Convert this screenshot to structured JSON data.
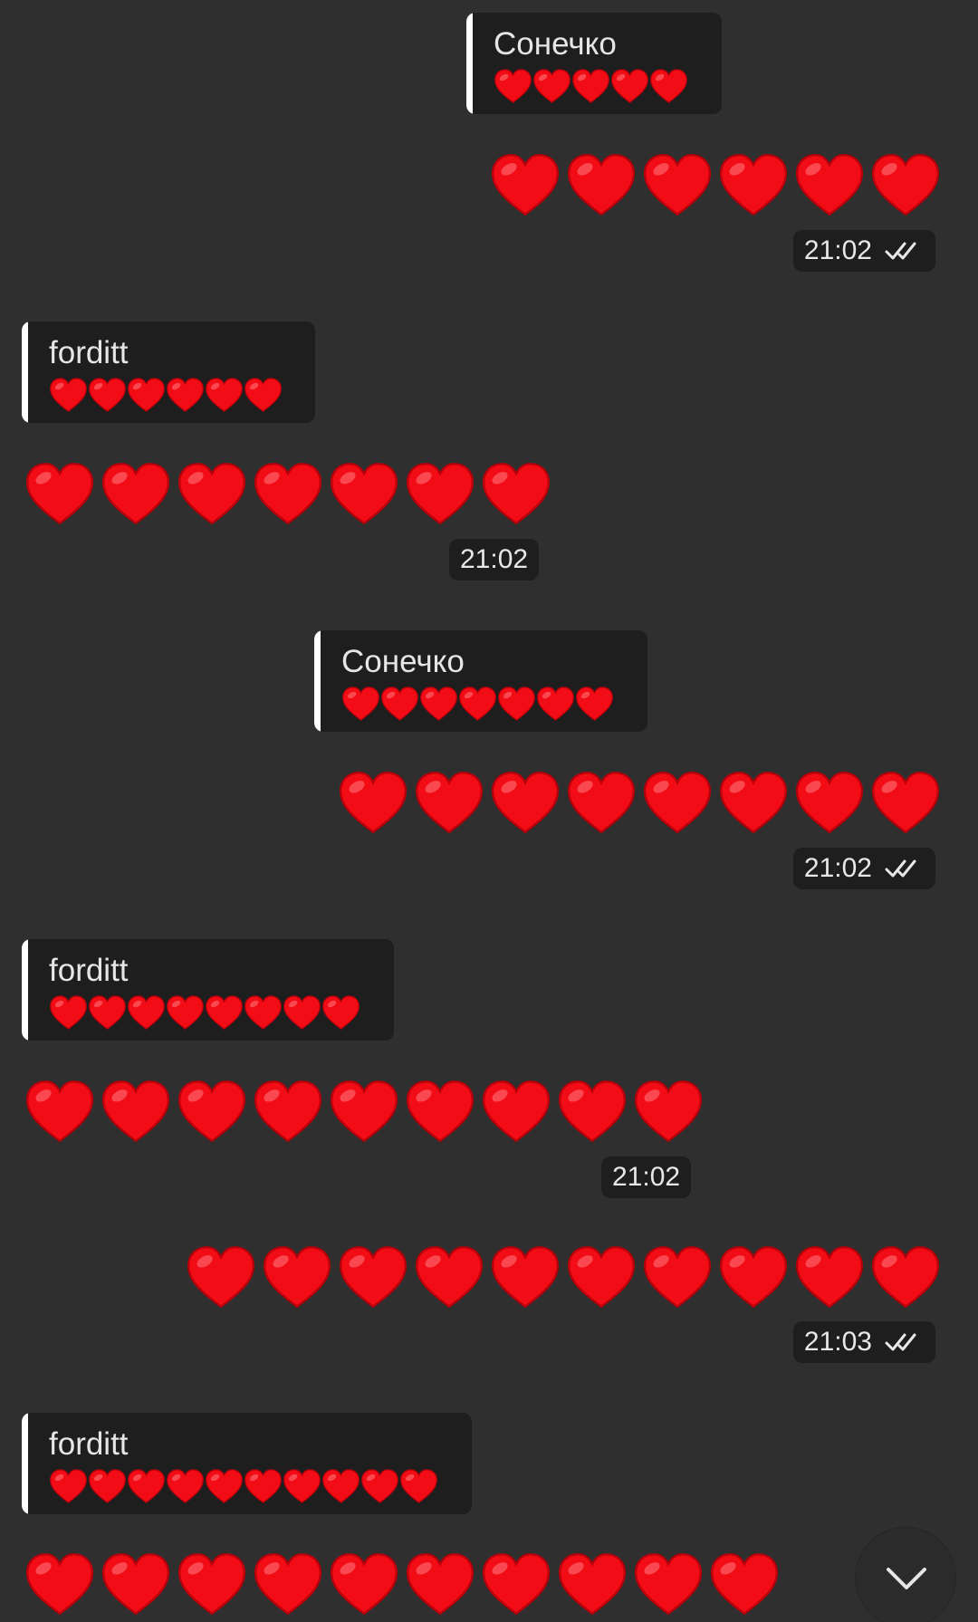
{
  "colors": {
    "background": "#2f2f30",
    "bubble": "#1e1e1f",
    "heart": "#f20d16",
    "accent_bar": "#ffffff",
    "text": "#e6e6e6"
  },
  "messages": [
    {
      "side": "outgoing",
      "reply": {
        "author": "Сонечко",
        "text": "❤️❤️❤️❤️❤️",
        "hearts": 5
      },
      "text": "❤️❤️❤️❤️❤️❤️",
      "hearts": 6,
      "time": "21:02",
      "status_icon": "double-check-icon"
    },
    {
      "side": "incoming",
      "reply": {
        "author": "forditt",
        "text": "❤️❤️❤️❤️❤️❤️",
        "hearts": 6
      },
      "text": "❤️❤️❤️❤️❤️❤️❤️",
      "hearts": 7,
      "time": "21:02"
    },
    {
      "side": "outgoing",
      "reply": {
        "author": "Сонечко",
        "text": "❤️❤️❤️❤️❤️❤️❤️",
        "hearts": 7
      },
      "text": "❤️❤️❤️❤️❤️❤️❤️❤️",
      "hearts": 8,
      "time": "21:02",
      "status_icon": "double-check-icon"
    },
    {
      "side": "incoming",
      "reply": {
        "author": "forditt",
        "text": "❤️❤️❤️❤️❤️❤️❤️❤️",
        "hearts": 8
      },
      "text": "❤️❤️❤️❤️❤️❤️❤️❤️❤️",
      "hearts": 9,
      "time": "21:02"
    },
    {
      "side": "outgoing",
      "text": "❤️❤️❤️❤️❤️❤️❤️❤️❤️❤️",
      "hearts": 10,
      "time": "21:03",
      "status_icon": "double-check-icon"
    },
    {
      "side": "incoming",
      "reply": {
        "author": "forditt",
        "text": "❤️❤️❤️❤️❤️❤️❤️❤️❤️❤️",
        "hearts": 10
      },
      "text": "❤️❤️❤️❤️❤️❤️❤️❤️❤️❤️",
      "hearts": 10
    }
  ],
  "scroll_button": {
    "icon": "chevron-down-icon"
  }
}
